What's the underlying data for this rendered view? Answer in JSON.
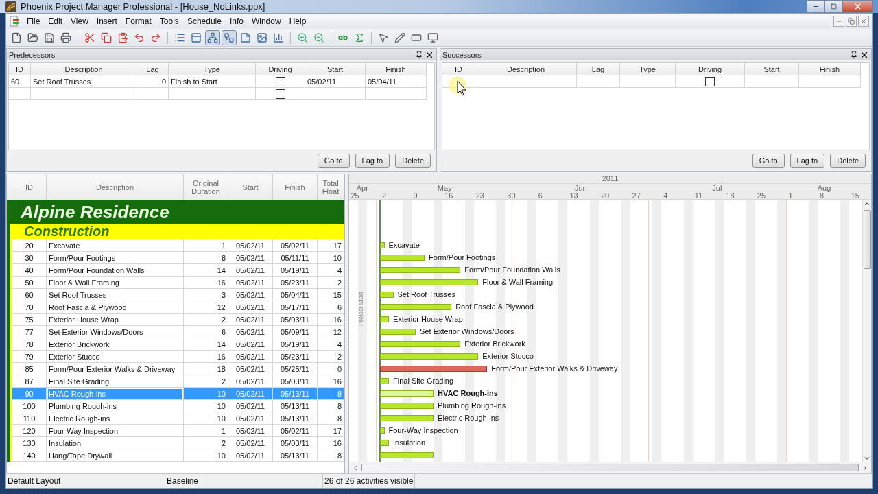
{
  "window": {
    "title": "Phoenix Project Manager Professional - [House_NoLinks.ppx]"
  },
  "menu": [
    "File",
    "Edit",
    "View",
    "Insert",
    "Format",
    "Tools",
    "Schedule",
    "Info",
    "Window",
    "Help"
  ],
  "toolbar": [
    [
      {
        "pressed": false
      },
      {
        "pressed": false
      },
      {
        "pressed": false
      },
      {
        "pressed": false
      }
    ],
    [
      {
        "pressed": false
      },
      {
        "pressed": false
      },
      {
        "pressed": false
      },
      {
        "pressed": false
      },
      {
        "pressed": false
      }
    ],
    [
      {
        "pressed": false
      },
      {
        "pressed": false
      },
      {
        "pressed": true
      },
      {
        "pressed": true
      },
      {
        "pressed": false
      },
      {
        "pressed": false
      },
      {
        "pressed": false
      }
    ],
    [
      {
        "pressed": false
      },
      {
        "pressed": false
      }
    ],
    [
      {
        "pressed": false
      },
      {
        "pressed": false
      }
    ],
    [
      {
        "pressed": false
      },
      {
        "pressed": false
      },
      {
        "pressed": false
      },
      {
        "pressed": false
      }
    ]
  ],
  "predecessors": {
    "title": "Predecessors",
    "columns": [
      "ID",
      "Description",
      "Lag",
      "Type",
      "Driving",
      "Start",
      "Finish"
    ],
    "rows": [
      {
        "id": "60",
        "description": "Set Roof Trusses",
        "lag": "0",
        "type": "Finish to Start",
        "driving": false,
        "start": "05/02/11",
        "finish": "05/04/11"
      },
      {
        "driving": false
      }
    ],
    "buttons": [
      "Go to",
      "Lag to",
      "Delete"
    ]
  },
  "successors": {
    "title": "Successors",
    "columns": [
      "ID",
      "Description",
      "Lag",
      "Type",
      "Driving",
      "Start",
      "Finish"
    ],
    "rows": [
      {
        "driving": false
      }
    ],
    "buttons": [
      "Go to",
      "Lag to",
      "Delete"
    ]
  },
  "schedule": {
    "columns": [
      "ID",
      "Description",
      "Original Duration",
      "Start",
      "Finish",
      "Total Float"
    ],
    "project": "Alpine Residence",
    "wbs": "Construction",
    "rows": [
      {
        "id": "20",
        "description": "Excavate",
        "duration": "1",
        "start": "05/02/11",
        "finish": "05/02/11",
        "float": "17",
        "critical": false,
        "selected": false,
        "bar_label": "Excavate"
      },
      {
        "id": "30",
        "description": "Form/Pour Footings",
        "duration": "8",
        "start": "05/02/11",
        "finish": "05/11/11",
        "float": "10",
        "critical": false,
        "selected": false,
        "bar_label": "Form/Pour Footings"
      },
      {
        "id": "40",
        "description": "Form/Pour Foundation Walls",
        "duration": "14",
        "start": "05/02/11",
        "finish": "05/19/11",
        "float": "4",
        "critical": false,
        "selected": false,
        "bar_label": "Form/Pour Foundation Walls"
      },
      {
        "id": "50",
        "description": "Floor & Wall Framing",
        "duration": "16",
        "start": "05/02/11",
        "finish": "05/23/11",
        "float": "2",
        "critical": false,
        "selected": false,
        "bar_label": "Floor & Wall Framing"
      },
      {
        "id": "60",
        "description": "Set Roof Trusses",
        "duration": "3",
        "start": "05/02/11",
        "finish": "05/04/11",
        "float": "15",
        "critical": false,
        "selected": false,
        "bar_label": "Set Roof Trusses"
      },
      {
        "id": "70",
        "description": "Roof Fascia & Plywood",
        "duration": "12",
        "start": "05/02/11",
        "finish": "05/17/11",
        "float": "6",
        "critical": false,
        "selected": false,
        "bar_label": "Roof Fascia & Plywood"
      },
      {
        "id": "75",
        "description": "Exterior House Wrap",
        "duration": "2",
        "start": "05/02/11",
        "finish": "05/03/11",
        "float": "16",
        "critical": false,
        "selected": false,
        "bar_label": "Exterior House Wrap"
      },
      {
        "id": "77",
        "description": "Set Exterior Windows/Doors",
        "duration": "6",
        "start": "05/02/11",
        "finish": "05/09/11",
        "float": "12",
        "critical": false,
        "selected": false,
        "bar_label": "Set Exterior Windows/Doors"
      },
      {
        "id": "78",
        "description": "Exterior Brickwork",
        "duration": "14",
        "start": "05/02/11",
        "finish": "05/19/11",
        "float": "4",
        "critical": false,
        "selected": false,
        "bar_label": "Exterior Brickwork"
      },
      {
        "id": "79",
        "description": "Exterior Stucco",
        "duration": "16",
        "start": "05/02/11",
        "finish": "05/23/11",
        "float": "2",
        "critical": false,
        "selected": false,
        "bar_label": "Exterior Stucco"
      },
      {
        "id": "85",
        "description": "Form/Pour Exterior Walks & Driveway",
        "duration": "18",
        "start": "05/02/11",
        "finish": "05/25/11",
        "float": "0",
        "critical": true,
        "selected": false,
        "bar_label": "Form/Pour Exterior Walks & Driveway"
      },
      {
        "id": "87",
        "description": "Final Site Grading",
        "duration": "2",
        "start": "05/02/11",
        "finish": "05/03/11",
        "float": "16",
        "critical": false,
        "selected": false,
        "bar_label": "Final Site Grading"
      },
      {
        "id": "90",
        "description": "HVAC Rough-ins",
        "duration": "10",
        "start": "05/02/11",
        "finish": "05/13/11",
        "float": "8",
        "critical": false,
        "selected": true,
        "bar_label": "HVAC Rough-ins"
      },
      {
        "id": "100",
        "description": "Plumbing Rough-ins",
        "duration": "10",
        "start": "05/02/11",
        "finish": "05/13/11",
        "float": "8",
        "critical": false,
        "selected": false,
        "bar_label": "Plumbing Rough-ins"
      },
      {
        "id": "110",
        "description": "Electric Rough-ins",
        "duration": "10",
        "start": "05/02/11",
        "finish": "05/13/11",
        "float": "8",
        "critical": false,
        "selected": false,
        "bar_label": "Electric Rough-ins"
      },
      {
        "id": "120",
        "description": "Four-Way Inspection",
        "duration": "1",
        "start": "05/02/11",
        "finish": "05/02/11",
        "float": "17",
        "critical": false,
        "selected": false,
        "bar_label": "Four-Way Inspection"
      },
      {
        "id": "130",
        "description": "Insulation",
        "duration": "2",
        "start": "05/02/11",
        "finish": "05/03/11",
        "float": "16",
        "critical": false,
        "selected": false,
        "bar_label": "Insulation"
      },
      {
        "id": "140",
        "description": "Hang/Tape Drywall",
        "duration": "10",
        "start": "05/02/11",
        "finish": "05/13/11",
        "float": "8",
        "critical": false,
        "selected": false
      }
    ]
  },
  "timeline": {
    "year": "2011",
    "months": [
      "Apr",
      "May",
      "Jun",
      "Jul",
      "Aug"
    ],
    "days": [
      "25",
      "2",
      "9",
      "16",
      "23",
      "30",
      "6",
      "13",
      "20",
      "27",
      "4",
      "11",
      "18",
      "25",
      "1",
      "8",
      "15"
    ],
    "project_start_label": "Project Start"
  },
  "status_bar": [
    "Default Layout",
    "Baseline",
    "26 of 26 activities visible"
  ]
}
